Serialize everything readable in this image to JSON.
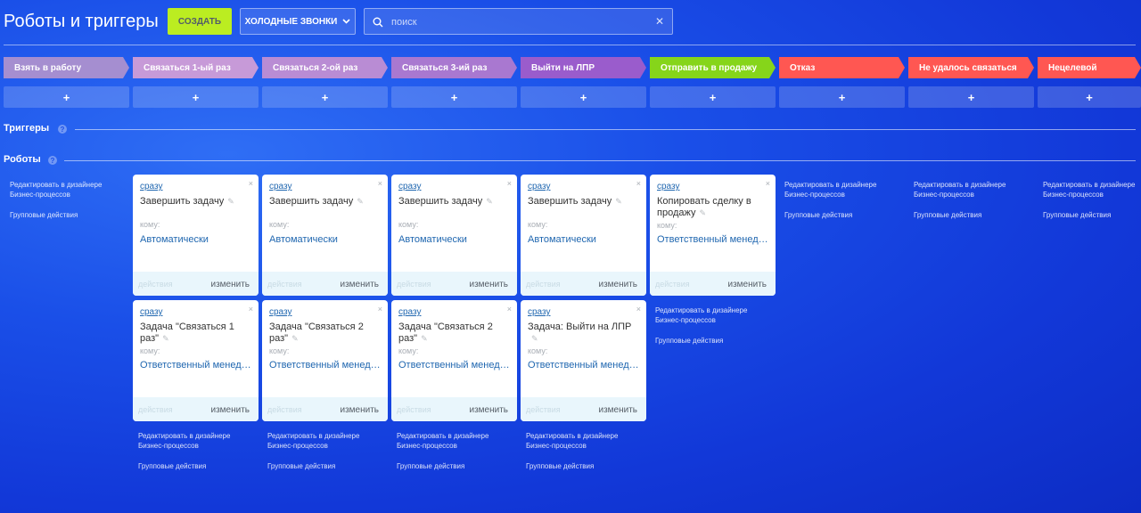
{
  "header": {
    "title": "Роботы и триггеры",
    "create_label": "СОЗДАТЬ",
    "category_label": "ХОЛОДНЫЕ ЗВОНКИ",
    "search_placeholder": "поиск"
  },
  "stages": [
    {
      "label": "Взять в работу",
      "color": "#a58ed0"
    },
    {
      "label": "Связаться 1-ый раз",
      "color": "#c79ad8"
    },
    {
      "label": "Связаться 2-ой раз",
      "color": "#b98cd4"
    },
    {
      "label": "Связаться 3-ий раз",
      "color": "#a978d0"
    },
    {
      "label": "Выйти на ЛПР",
      "color": "#9a5ccc"
    },
    {
      "label": "Отправить в продажу",
      "color": "#86d51a"
    },
    {
      "label": "Отказ",
      "color": "#ff5752"
    },
    {
      "label": "Не удалось связаться",
      "color": "#ff5752"
    },
    {
      "label": "Нецелевой",
      "color": "#ff5752"
    }
  ],
  "add_label": "+",
  "sections": {
    "triggers": "Триггеры",
    "robots": "Роботы",
    "help": "?"
  },
  "card_common": {
    "delay": "сразу",
    "to": "кому:",
    "actions": "действия",
    "edit": "изменить",
    "close": "×",
    "pencil": "✎"
  },
  "robots": [
    {
      "title": "Завершить задачу",
      "who": "Автоматически"
    },
    {
      "title": "Завершить задачу",
      "who": "Автоматически"
    },
    {
      "title": "Завершить задачу",
      "who": "Автоматически"
    },
    {
      "title": "Завершить задачу",
      "who": "Автоматически"
    },
    {
      "title": "Копировать сделку в продажу",
      "who": "Ответственный менеджер"
    },
    {
      "title": "Задача \"Связаться 1 раз\"",
      "who": "Ответственный менеджер"
    },
    {
      "title": "Задача \"Связаться 2 раз\"",
      "who": "Ответственный менеджер"
    },
    {
      "title": "Задача \"Связаться 2 раз\"",
      "who": "Ответственный менеджер"
    },
    {
      "title": "Задача: Выйти на ЛПР",
      "who": "Ответственный менеджер"
    }
  ],
  "links": {
    "designer": "Редактировать в дизайнере Бизнес-процессов",
    "group": "Групповые действия"
  }
}
